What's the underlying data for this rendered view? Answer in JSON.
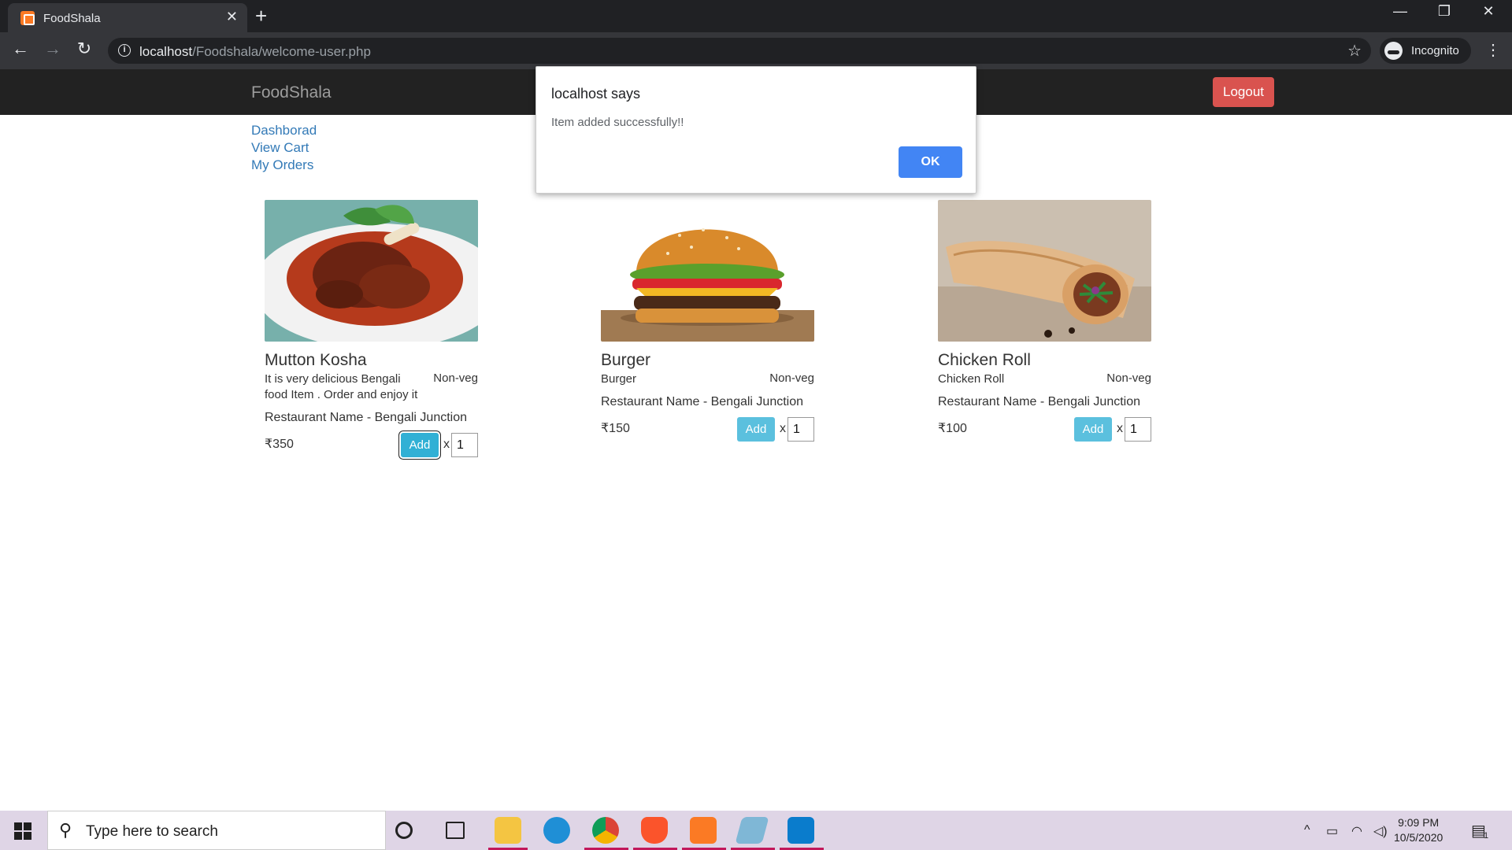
{
  "browser": {
    "tab_title": "FoodShala",
    "url_host": "localhost",
    "url_path": "/Foodshala/welcome-user.php",
    "profile_label": "Incognito"
  },
  "site": {
    "brand": "FoodShala",
    "logout_label": "Logout",
    "links": [
      "Dashborad",
      "View Cart",
      "My Orders"
    ]
  },
  "items": [
    {
      "name": "Mutton Kosha",
      "description": "It is very delicious Bengali food Item . Order and enjoy it",
      "type": "Non-veg",
      "restaurant": "Restaurant Name - Bengali Junction",
      "price": "₹350",
      "add_label": "Add",
      "times": "x",
      "qty": "1"
    },
    {
      "name": "Burger",
      "description": "Burger",
      "type": "Non-veg",
      "restaurant": "Restaurant Name - Bengali Junction",
      "price": "₹150",
      "add_label": "Add",
      "times": "x",
      "qty": "1"
    },
    {
      "name": "Chicken Roll",
      "description": "Chicken Roll",
      "type": "Non-veg",
      "restaurant": "Restaurant Name - Bengali Junction",
      "price": "₹100",
      "add_label": "Add",
      "times": "x",
      "qty": "1"
    }
  ],
  "dialog": {
    "title": "localhost says",
    "message": "Item added successfully!!",
    "ok_label": "OK"
  },
  "taskbar": {
    "search_placeholder": "Type here to search",
    "time": "9:09 PM",
    "date": "10/5/2020",
    "notification_count": "1"
  },
  "colors": {
    "navbar": "#222222",
    "logout": "#d9534f",
    "add_button": "#5bc0de",
    "link": "#337ab7",
    "dialog_ok": "#4285f4"
  }
}
